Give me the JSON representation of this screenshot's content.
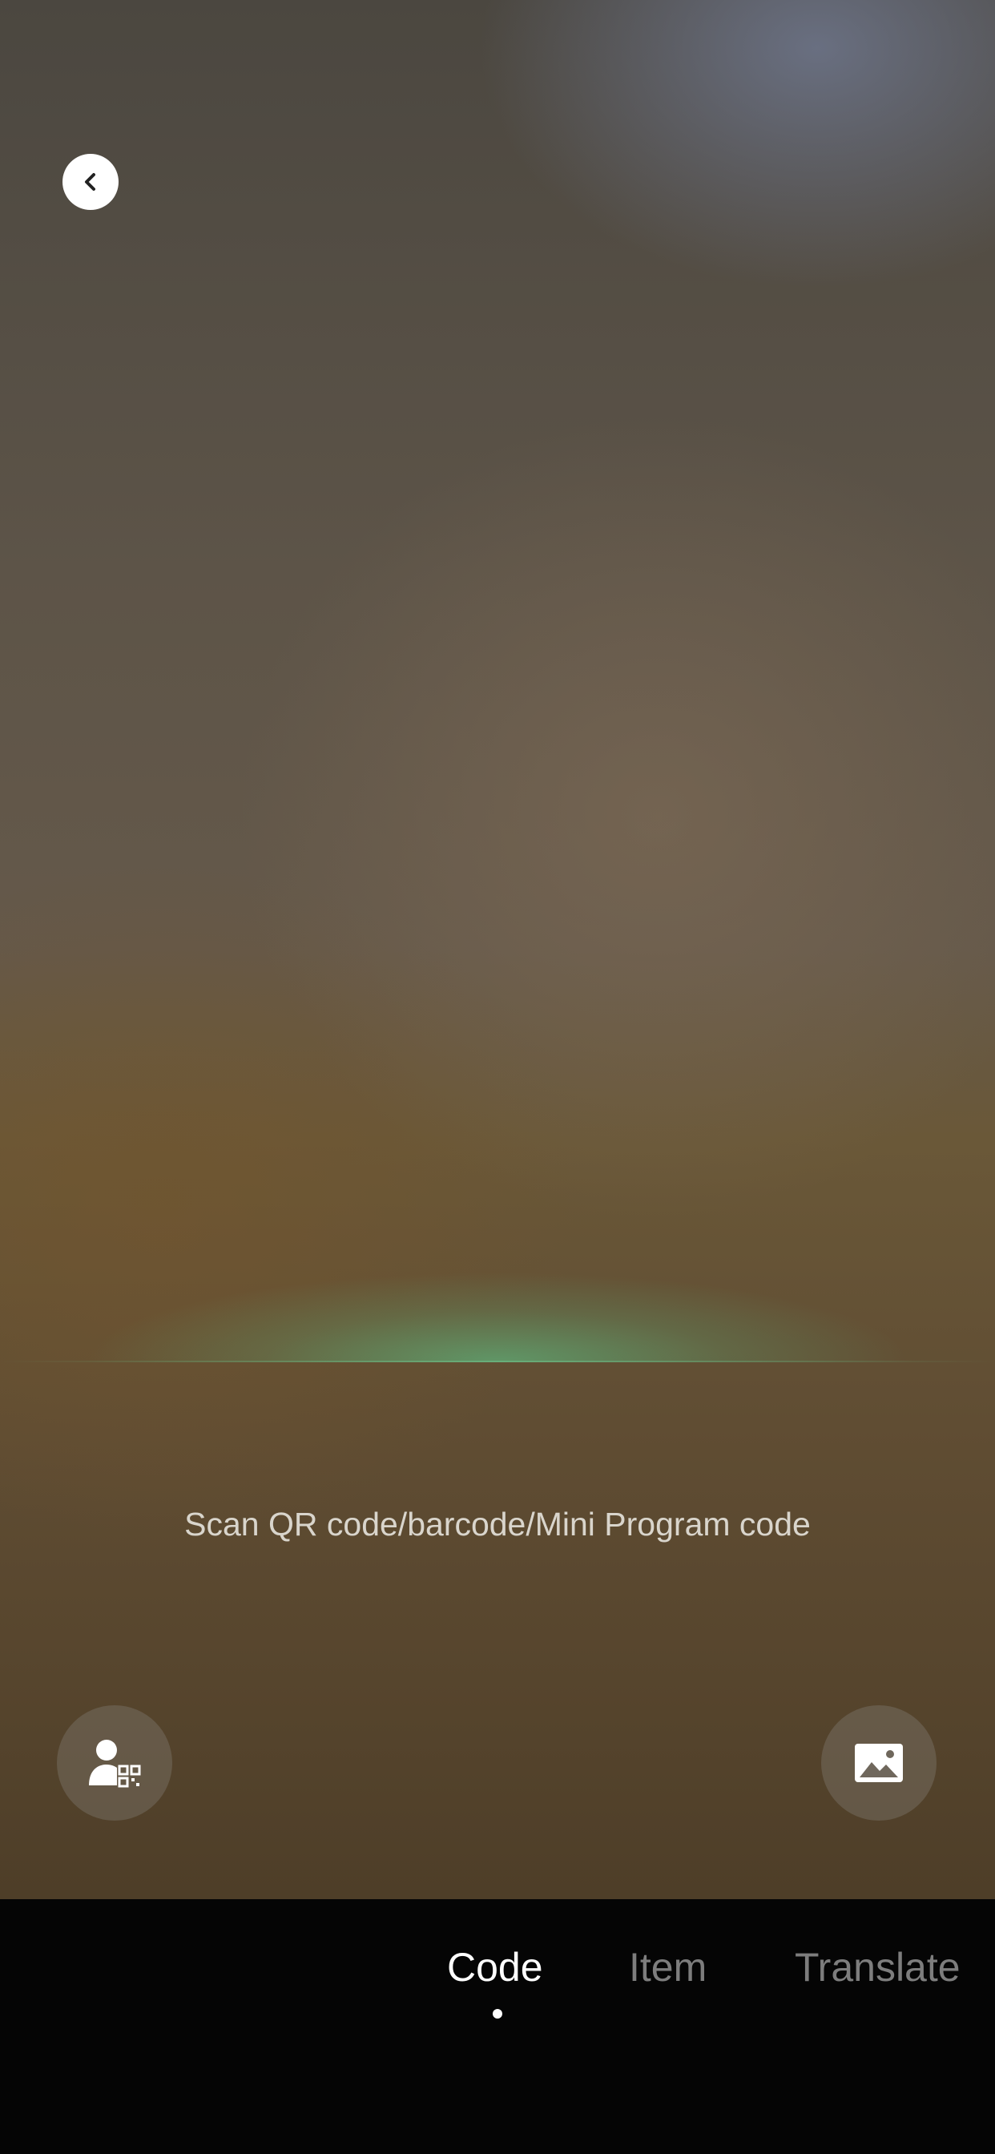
{
  "scanner": {
    "hint": "Scan QR code/barcode/Mini Program code"
  },
  "icons": {
    "back": "chevron-left-icon",
    "my_qr_code": "person-qr-code-icon",
    "album": "image-icon"
  },
  "tabs": [
    {
      "label": "Code",
      "selected": true
    },
    {
      "label": "Item",
      "selected": false
    },
    {
      "label": "Translate",
      "selected": false
    }
  ],
  "colors": {
    "scan_line": "#5faf78",
    "tab_selected": "#ffffff",
    "tab_unselected": "#7d7d7d",
    "bottom_bar": "#050505"
  }
}
